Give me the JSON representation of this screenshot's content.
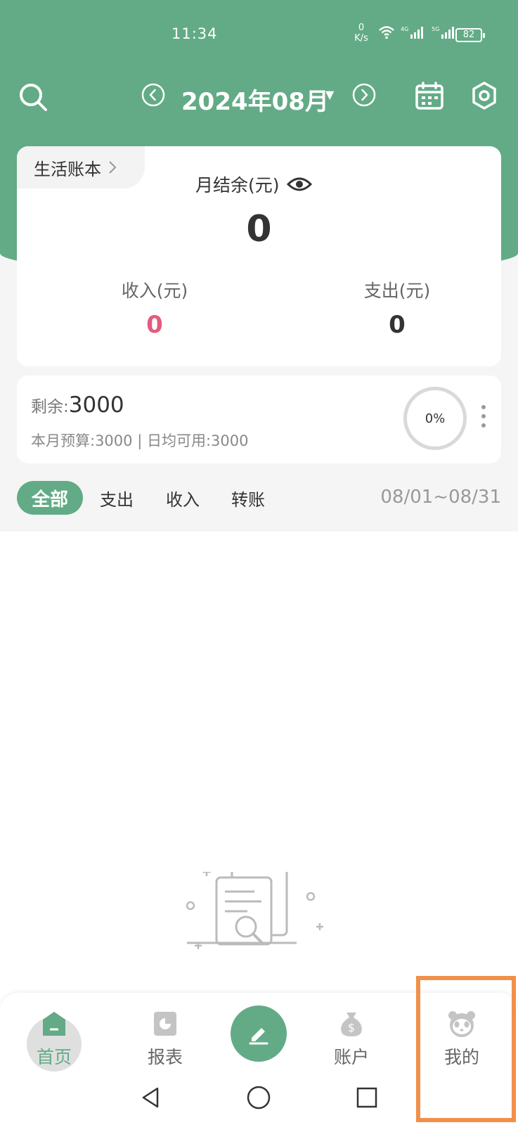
{
  "status_bar": {
    "time": "11:34",
    "net_speed_value": "0",
    "net_speed_unit": "K/s",
    "battery": "82"
  },
  "topbar": {
    "month": "2024年08月",
    "icons": [
      "search-icon",
      "chevron-left-icon",
      "chevron-right-icon",
      "calendar-icon",
      "settings-icon"
    ]
  },
  "balance_card": {
    "book_name": "生活账本",
    "balance_label": "月结余(元)",
    "balance_value": "0",
    "income_label": "收入(元)",
    "income_value": "0",
    "expense_label": "支出(元)",
    "expense_value": "0"
  },
  "budget_card": {
    "remain_label": "剩余:",
    "remain_value": "3000",
    "subtitle": "本月预算:3000 | 日均可用:3000",
    "progress_text": "0%",
    "progress": 0
  },
  "filters": {
    "items": [
      "全部",
      "支出",
      "收入",
      "转账"
    ],
    "active_index": 0,
    "date_range": "08/01~08/31"
  },
  "tabbar": {
    "items": [
      {
        "label": "首页",
        "icon": "home-icon"
      },
      {
        "label": "报表",
        "icon": "report-icon"
      },
      {
        "label": "账户",
        "icon": "money-bag-icon"
      },
      {
        "label": "我的",
        "icon": "panda-icon"
      }
    ],
    "active_index": 0,
    "fab_icon": "pen-icon"
  },
  "colors": {
    "brand": "#62ab86",
    "income": "#e45a7c",
    "highlight": "#f0904a"
  }
}
